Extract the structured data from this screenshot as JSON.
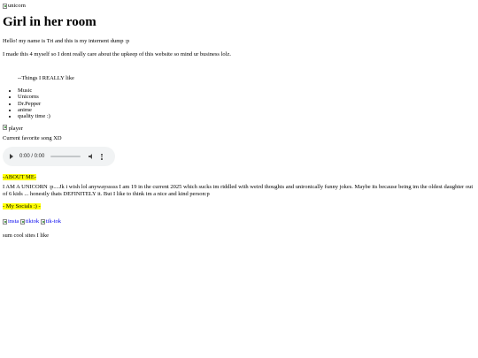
{
  "header": {
    "unicorn_img_alt": "unicorn",
    "title": "Girl in her room"
  },
  "intro": {
    "line1": "Hello! my name is Tri and this is my internent dump :p",
    "line2": "I made this 4 myself so I dont really care about the upkeep of this website so mind ur business lolz."
  },
  "likes": {
    "heading": "--Things I REALLY like",
    "items": [
      "Music",
      "Unicorns",
      "Dr.Pepper",
      "anime",
      "quality time :)"
    ]
  },
  "music": {
    "player_img_alt": "player",
    "favorite_label": "Current favorite song XD",
    "audio": {
      "time": "0:00 / 0:00"
    }
  },
  "about": {
    "heading": "-ABOUT ME-",
    "text": "I AM A UNICORN :p....Jk i wish lol anywaysssss I am 19 in the current 2025 which sucks im riddled with weird thoughts and unironically funny jokes. Maybe its because being im the oldest daughter out of 6 kids ... honestly thats DEFINITELY it. But I like to think im a nice and kind person:p"
  },
  "socials": {
    "heading": "- My Socials :) -",
    "links": [
      {
        "alt": "insta"
      },
      {
        "alt": "tiktok"
      },
      {
        "alt": "tik-tok"
      }
    ],
    "footer": "sum cool sites I like"
  },
  "colors": {
    "highlight": "#ffff00",
    "link": "#0000ee",
    "audio_bg": "#f1f3f4"
  }
}
